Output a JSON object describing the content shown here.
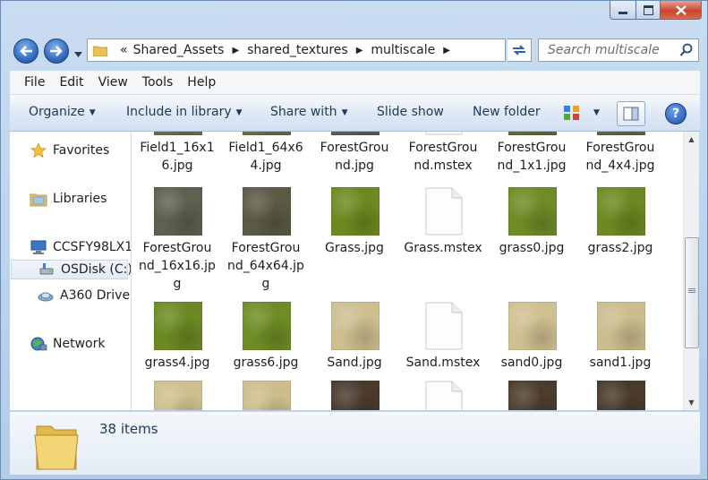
{
  "window": {
    "caption_buttons": [
      "minimize-icon",
      "maximize-icon",
      "close-icon"
    ]
  },
  "address": {
    "overflow_marker": "«",
    "segments": [
      "Shared_Assets",
      "shared_textures",
      "multiscale"
    ]
  },
  "search": {
    "placeholder": "Search multiscale"
  },
  "menu": {
    "items": [
      "File",
      "Edit",
      "View",
      "Tools",
      "Help"
    ]
  },
  "toolbar": {
    "organize": "Organize",
    "include_in_library": "Include in library",
    "share_with": "Share with",
    "slide_show": "Slide show",
    "new_folder": "New folder"
  },
  "nav": {
    "favorites": "Favorites",
    "libraries": "Libraries",
    "computer": "CCSFY98LX1",
    "osdisk": "OSDisk (C:)",
    "a360": "A360 Drive",
    "network": "Network"
  },
  "files": {
    "row0": [
      {
        "name": "Field1_16x16.jpg",
        "lines": [
          "Field1_16x1",
          "6.jpg"
        ],
        "kind": "image",
        "color": "#6e6a49"
      },
      {
        "name": "Field1_64x64.jpg",
        "lines": [
          "Field1_64x6",
          "4.jpg"
        ],
        "kind": "image",
        "color": "#6a6a45"
      },
      {
        "name": "ForestGround.jpg",
        "lines": [
          "ForestGrou",
          "nd.jpg"
        ],
        "kind": "image",
        "color": "#5a5c58"
      },
      {
        "name": "ForestGround.mstex",
        "lines": [
          "ForestGrou",
          "nd.mstex"
        ],
        "kind": "document",
        "color": "#ffffff"
      },
      {
        "name": "ForestGround_1x1.jpg",
        "lines": [
          "ForestGrou",
          "nd_1x1.jpg"
        ],
        "kind": "image",
        "color": "#5f6a3a"
      },
      {
        "name": "ForestGround_4x4.jpg",
        "lines": [
          "ForestGrou",
          "nd_4x4.jpg"
        ],
        "kind": "image",
        "color": "#5d6640"
      }
    ],
    "row1": [
      {
        "name": "ForestGround_16x16.jpg",
        "lines": [
          "ForestGrou",
          "nd_16x16.jp",
          "g"
        ],
        "kind": "image",
        "color": "#5e614f"
      },
      {
        "name": "ForestGround_64x64.jpg",
        "lines": [
          "ForestGrou",
          "nd_64x64.jp",
          "g"
        ],
        "kind": "image",
        "color": "#5b5a45"
      },
      {
        "name": "Grass.jpg",
        "lines": [
          "Grass.jpg"
        ],
        "kind": "image",
        "color": "#6d8a20"
      },
      {
        "name": "Grass.mstex",
        "lines": [
          "Grass.mstex"
        ],
        "kind": "document",
        "color": "#ffffff"
      },
      {
        "name": "grass0.jpg",
        "lines": [
          "grass0.jpg"
        ],
        "kind": "image",
        "color": "#6f8c26"
      },
      {
        "name": "grass2.jpg",
        "lines": [
          "grass2.jpg"
        ],
        "kind": "image",
        "color": "#6c8a21"
      }
    ],
    "row2": [
      {
        "name": "grass4.jpg",
        "lines": [
          "grass4.jpg"
        ],
        "kind": "image",
        "color": "#6b8a22"
      },
      {
        "name": "grass6.jpg",
        "lines": [
          "grass6.jpg"
        ],
        "kind": "image",
        "color": "#6e8d25"
      },
      {
        "name": "Sand.jpg",
        "lines": [
          "Sand.jpg"
        ],
        "kind": "image",
        "color": "#cdbf8f"
      },
      {
        "name": "Sand.mstex",
        "lines": [
          "Sand.mstex"
        ],
        "kind": "document",
        "color": "#ffffff"
      },
      {
        "name": "sand0.jpg",
        "lines": [
          "sand0.jpg"
        ],
        "kind": "image",
        "color": "#cfc091"
      },
      {
        "name": "sand1.jpg",
        "lines": [
          "sand1.jpg"
        ],
        "kind": "image",
        "color": "#cbbd8d"
      }
    ],
    "row3": [
      {
        "kind": "image",
        "color": "#cdbf8e"
      },
      {
        "kind": "image",
        "color": "#cbbd8c"
      },
      {
        "kind": "image",
        "color": "#4a3a2c"
      },
      {
        "kind": "document",
        "color": "#ffffff"
      },
      {
        "kind": "image",
        "color": "#4c3c2d"
      },
      {
        "kind": "image",
        "color": "#4a3a2b"
      }
    ]
  },
  "details": {
    "count": "38 items"
  },
  "colors": {
    "accent": "#1e395b",
    "window_frame": "#b4cbe6",
    "close_red": "#c7452c"
  }
}
